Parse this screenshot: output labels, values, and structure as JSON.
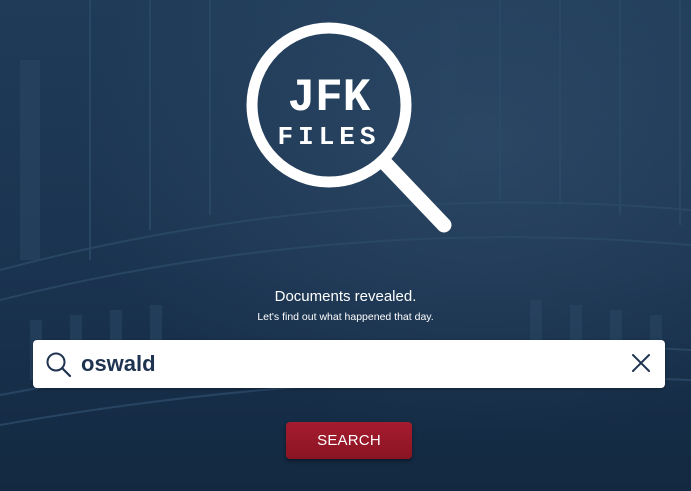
{
  "logo": {
    "title": "JFK",
    "subtitle": "FILES"
  },
  "tagline": {
    "main": "Documents revealed.",
    "sub": "Let's find out what happened that day."
  },
  "search": {
    "value": "oswald",
    "button_label": "SEARCH"
  },
  "icons": {
    "search": "search-icon",
    "clear": "close-icon"
  },
  "colors": {
    "background": "#1b3550",
    "button": "#a51c2f",
    "input_text": "#1e3350"
  }
}
